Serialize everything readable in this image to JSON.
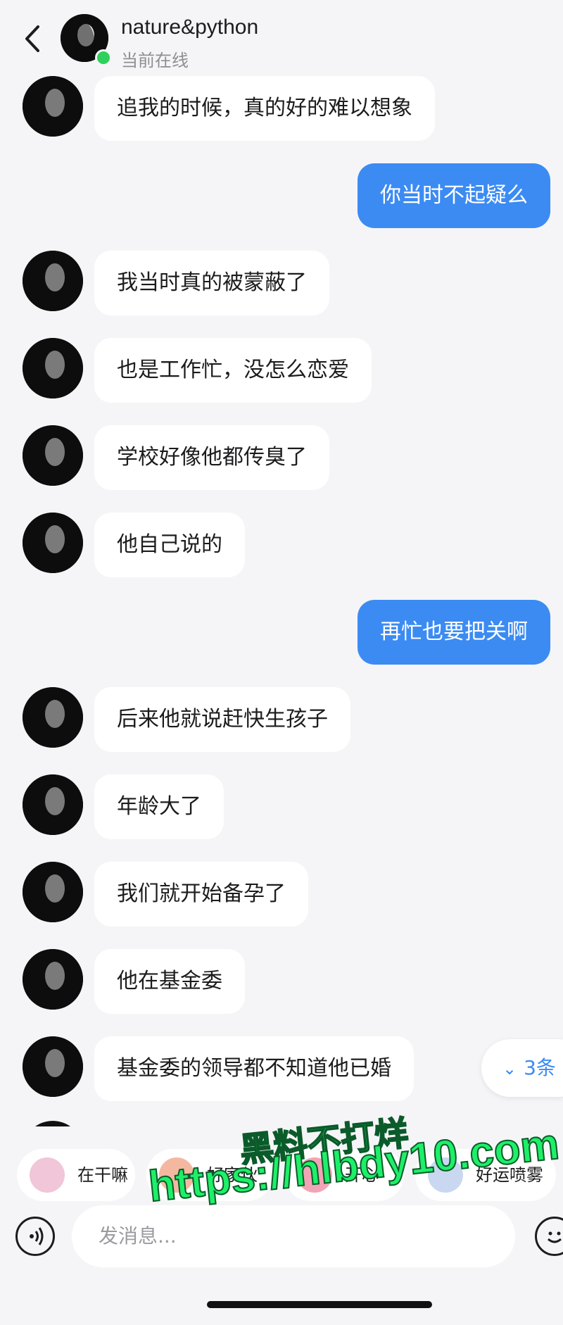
{
  "header": {
    "title": "nature&python",
    "status": "当前在线"
  },
  "messages": [
    {
      "side": "in",
      "text": "追我的时候，真的好的难以想象"
    },
    {
      "side": "out",
      "text": "你当时不起疑么"
    },
    {
      "side": "in",
      "text": "我当时真的被蒙蔽了"
    },
    {
      "side": "in",
      "text": "也是工作忙，没怎么恋爱"
    },
    {
      "side": "in",
      "text": "学校好像他都传臭了"
    },
    {
      "side": "in",
      "text": "他自己说的"
    },
    {
      "side": "out",
      "text": "再忙也要把关啊"
    },
    {
      "side": "in",
      "text": "后来他就说赶快生孩子"
    },
    {
      "side": "in",
      "text": "年龄大了"
    },
    {
      "side": "in",
      "text": "我们就开始备孕了"
    },
    {
      "side": "in",
      "text": "他在基金委"
    },
    {
      "side": "in",
      "text": "基金委的领导都不知道他已婚"
    }
  ],
  "unread": {
    "label": "3条"
  },
  "quick_replies": [
    {
      "label": "在干嘛",
      "emoji": "face-emoji",
      "color": "#f0c6d8"
    },
    {
      "label": "好家伙",
      "emoji": "peach-emoji",
      "color": "#f4b8a0"
    },
    {
      "label": "开心",
      "emoji": "heart-emoji",
      "color": "#f3a3b6"
    },
    {
      "label": "好运喷雾",
      "emoji": "spray-emoji",
      "color": "#c9d8f0"
    }
  ],
  "input": {
    "placeholder": "发消息..."
  },
  "watermark": {
    "line1": "黑料不打烊",
    "line2": "https://hlbdy10.com"
  },
  "colors": {
    "accent": "#3b8bf3",
    "online": "#2ed15b",
    "background": "#f5f5f7"
  }
}
